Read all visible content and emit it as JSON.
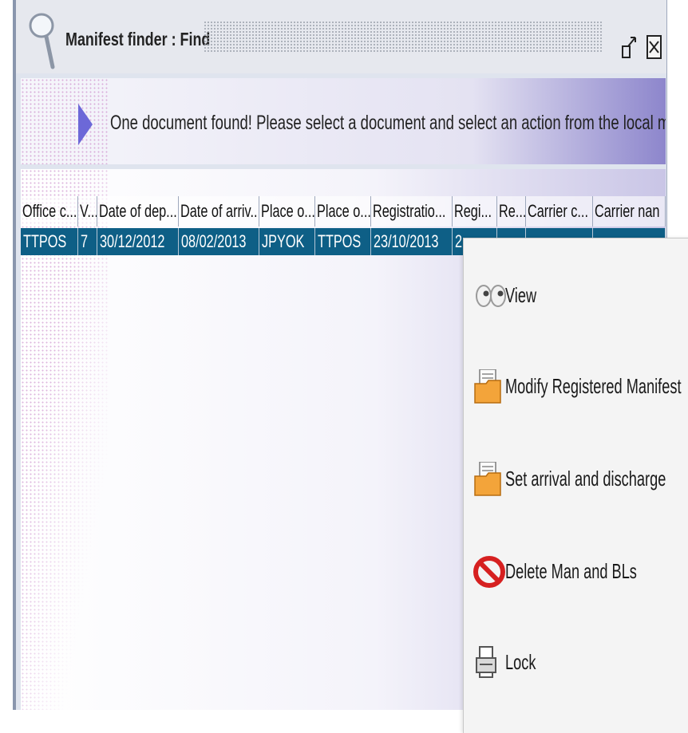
{
  "window": {
    "title": "Manifest finder : Find"
  },
  "banner": {
    "message": "One document found! Please select a document and select an action from the local menu"
  },
  "table": {
    "columns": [
      "Office c...",
      "V...",
      "Date of dep...",
      "Date of arriv...",
      "Place o...",
      "Place o...",
      "Registratio...",
      "Regi...",
      "Re...",
      "Carrier c...",
      "Carrier nan"
    ],
    "rows": [
      [
        "TTPOS",
        "7",
        "30/12/2012",
        "08/02/2013",
        "JPYOK",
        "TTPOS",
        "23/10/2013",
        "2",
        "",
        "",
        ""
      ]
    ],
    "selected_row": 0
  },
  "context_menu": {
    "items": [
      {
        "label": "View",
        "icon": "eyes-icon"
      },
      {
        "label": "Modify Registered Manifest",
        "icon": "folder-document-icon"
      },
      {
        "label": "Set arrival and discharge",
        "icon": "folder-document-icon"
      },
      {
        "label": "Delete Man and BLs",
        "icon": "no-entry-icon"
      },
      {
        "label": "Lock",
        "icon": "printer-lock-icon"
      }
    ]
  },
  "colors": {
    "selection": "#0e5f86",
    "banner_accent": "#6c68d8",
    "delete_red": "#d62020"
  }
}
